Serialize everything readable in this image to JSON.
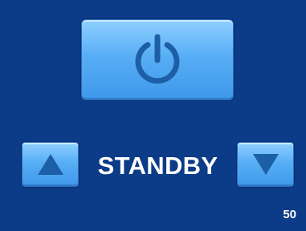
{
  "controls": {
    "power": {
      "icon": "power-icon"
    },
    "increase": {
      "icon": "triangle-up-icon"
    },
    "decrease": {
      "icon": "triangle-down-icon"
    }
  },
  "status": {
    "label": "STANDBY"
  },
  "value": {
    "label": "50"
  },
  "colors": {
    "background": "#0c3b87",
    "button": "#58aef5",
    "icon": "#1d5fa6",
    "text": "#ffffff"
  }
}
